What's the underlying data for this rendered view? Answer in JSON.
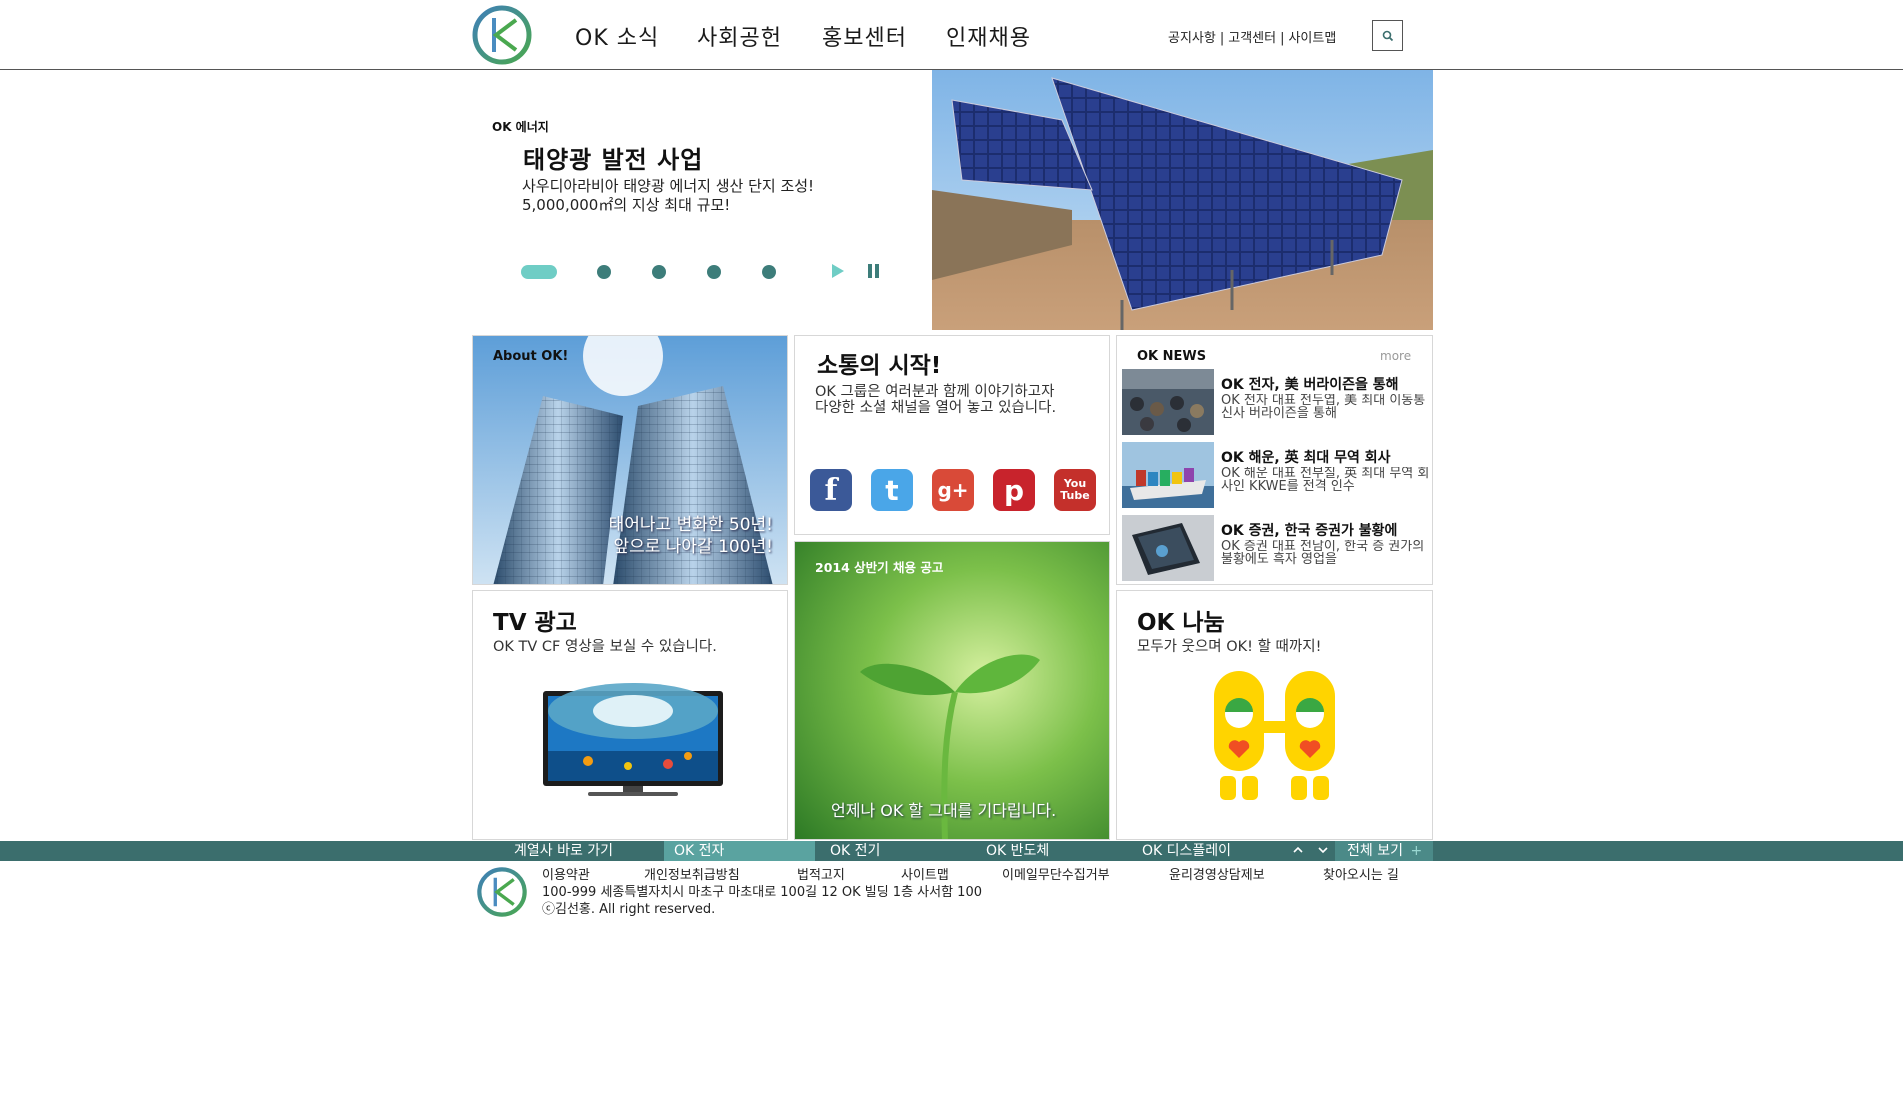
{
  "header": {
    "nav": [
      "OK 소식",
      "사회공헌",
      "홍보센터",
      "인재채용"
    ],
    "util_links": [
      "공지사항",
      "고객센터",
      "사이트맵"
    ],
    "util_separator": "|"
  },
  "hero": {
    "label": "OK 에너지",
    "title": "태양광 발전 사업",
    "desc_line1": "사우디아라비아 태양광 에너지 생산 단지 조성!",
    "desc_line2": "5,000,000㎡의 지상 최대 규모!",
    "slide_count": 5,
    "active_slide": 1
  },
  "about": {
    "label": "About OK!",
    "caption_line1": "태어나고 변화한 50년!",
    "caption_line2": "앞으로 나아갈 100년!"
  },
  "social": {
    "title": "소통의 시작!",
    "desc_line1": "OK 그룹은 여러분과 함께 이야기하고자",
    "desc_line2": "다양한 소셜 채널을 열어 놓고 있습니다.",
    "icons": [
      {
        "name": "facebook-icon",
        "glyph": "f",
        "color": "#3b5998"
      },
      {
        "name": "twitter-icon",
        "glyph": "t",
        "color": "#4aa6e8"
      },
      {
        "name": "google-plus-icon",
        "glyph": "g+",
        "color": "#d94a38"
      },
      {
        "name": "pinterest-icon",
        "glyph": "p",
        "color": "#c8232c"
      },
      {
        "name": "youtube-icon",
        "glyph": "You Tube",
        "color": "#c4302b"
      }
    ]
  },
  "news": {
    "title": "OK NEWS",
    "more": "more",
    "items": [
      {
        "title": "OK 전자, 美 버라이즌을 통해",
        "body": "OK 전자 대표 전두엽, 美 최대 이동통신사 버라이즌을 통해"
      },
      {
        "title": "OK 해운, 英 최대 무역 회사",
        "body": "OK 해운 대표 전부칠, 英 최대 무역 회사인 KKWE를 전격 인수"
      },
      {
        "title": "OK 증권, 한국 증권가 불황에",
        "body": "OK 증권 대표 전남이, 한국 증 권가의 불황에도 흑자 영업을"
      }
    ]
  },
  "tv": {
    "title": "TV 광고",
    "desc": "OK TV CF 영상을 보실 수 있습니다."
  },
  "recruit": {
    "label": "2014 상반기 채용 공고",
    "caption": "언제나 OK 할 그대를 기다립니다."
  },
  "share": {
    "title": "OK 나눔",
    "desc": "모두가 웃으며 OK! 할 때까지!"
  },
  "family": {
    "label": "계열사 바로 가기",
    "items": [
      "OK 전자",
      "OK 전기",
      "OK 반도체",
      "OK 디스플레이"
    ],
    "view_all": "전체 보기",
    "view_all_plus": "+"
  },
  "footer": {
    "links": [
      "이용약관",
      "개인정보취급방침",
      "법적고지",
      "사이트맵",
      "이메일무단수집거부",
      "윤리경영상담제보",
      "찾아오시는 길"
    ],
    "address": "100-999 세종특별자치시 마초구 마초대로 100길 12 OK 빌딩 1층 사서함 100",
    "copyright": "ⓒ김선홍. All right reserved."
  },
  "colors": {
    "teal_dark": "#3b6e6d",
    "teal_light": "#6fcdc5",
    "dot": "#3d7d7a"
  }
}
